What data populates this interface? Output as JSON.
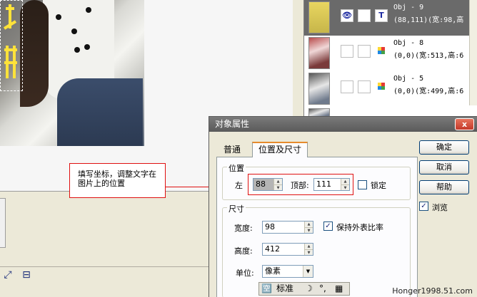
{
  "callout": {
    "line1": "填写坐标，调整文字在",
    "line2": "图片上的位置"
  },
  "object_list": [
    {
      "thumb": "text-yellow",
      "text_icon": "T",
      "name": "Obj - 9",
      "coords": "(88,111)(宽:98,高",
      "selected": true
    },
    {
      "thumb": "photo-1",
      "name": "Obj - 8",
      "coords": "(0,0)(宽:513,高:6",
      "selected": false
    },
    {
      "thumb": "photo-2",
      "name": "Obj - 5",
      "coords": "(0,0)(宽:499,高:6",
      "selected": false
    }
  ],
  "dialog": {
    "title": "对象属性",
    "close_label": "x",
    "tabs": [
      "普通",
      "位置及尺寸"
    ],
    "active_tab": "位置及尺寸",
    "position": {
      "group_label": "位置",
      "left_label": "左",
      "left_value": "88",
      "top_label": "顶部:",
      "top_value": "111",
      "lock_label": "锁定",
      "lock_checked": false
    },
    "size": {
      "group_label": "尺寸",
      "width_label": "宽度:",
      "width_value": "98",
      "height_label": "高度:",
      "height_value": "412",
      "keep_ratio_label": "保持外表比率",
      "keep_ratio_checked": true,
      "unit_label": "单位:",
      "unit_value": "像素"
    },
    "buttons": {
      "ok": "确定",
      "cancel": "取消",
      "help": "帮助"
    },
    "browse_label": "浏览",
    "browse_checked": true
  },
  "ime_bar": {
    "mode": "标准"
  },
  "watermark": "Honger1998.51.com",
  "colors": {
    "annotation_red": "#e01010",
    "selected_row": "#6a6a6a",
    "overlay_text_yellow": "#ffe23a"
  }
}
